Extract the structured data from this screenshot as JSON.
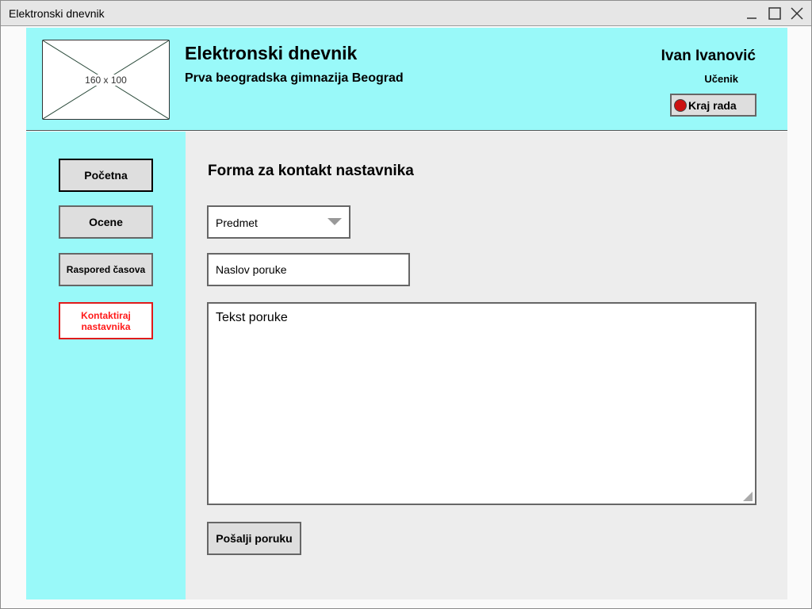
{
  "window": {
    "title": "Elektronski dnevnik",
    "controls": [
      "minimize-icon",
      "maximize-icon",
      "close-icon"
    ]
  },
  "header": {
    "logo_placeholder": "160 x 100",
    "app_title": "Elektronski dnevnik",
    "school": "Prva beogradska gimnazija Beograd",
    "user_name": "Ivan Ivanović",
    "user_role": "Učenik",
    "logout_label": "Kraj rada",
    "logout_icon": "stop-circle-icon"
  },
  "sidebar": {
    "items": [
      {
        "label": "Početna"
      },
      {
        "label": "Ocene"
      },
      {
        "label": "Raspored časova"
      },
      {
        "label": "Kontaktiraj nastavnika",
        "active": true
      }
    ]
  },
  "form": {
    "title": "Forma za kontakt nastavnika",
    "subject_select": "Predmet",
    "subject_placeholder": "Naslov poruke",
    "message_placeholder": "Tekst poruke",
    "send_label": "Pošalji poruku"
  },
  "colors": {
    "accent_cyan": "#99f9f9",
    "content_bg": "#ededed",
    "active_nav": "#ff1a1a",
    "logout_dot": "#cc1111"
  }
}
